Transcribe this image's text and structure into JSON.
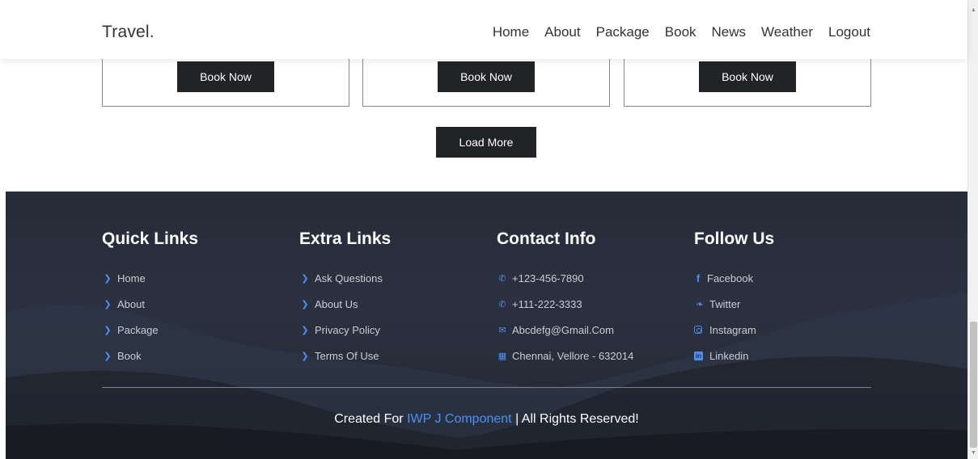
{
  "header": {
    "logo": "Travel.",
    "nav": [
      "Home",
      "About",
      "Package",
      "Book",
      "News",
      "Weather",
      "Logout"
    ]
  },
  "cards": [
    {
      "button": "Book Now"
    },
    {
      "button": "Book Now"
    },
    {
      "button": "Book Now"
    }
  ],
  "load_more": "Load More",
  "footer": {
    "quick_links": {
      "title": "Quick Links",
      "items": [
        "Home",
        "About",
        "Package",
        "Book"
      ]
    },
    "extra_links": {
      "title": "Extra Links",
      "items": [
        "Ask Questions",
        "About Us",
        "Privacy Policy",
        "Terms Of Use"
      ]
    },
    "contact_info": {
      "title": "Contact Info",
      "items": [
        {
          "icon": "phone-icon",
          "text": "+123-456-7890"
        },
        {
          "icon": "phone-icon",
          "text": "+111-222-3333"
        },
        {
          "icon": "envelope-icon",
          "text": "Abcdefg@Gmail.Com"
        },
        {
          "icon": "map-icon",
          "text": "Chennai, Vellore - 632014"
        }
      ]
    },
    "follow_us": {
      "title": "Follow Us",
      "items": [
        {
          "icon": "facebook-icon",
          "text": "Facebook"
        },
        {
          "icon": "twitter-icon",
          "text": "Twitter"
        },
        {
          "icon": "instagram-icon",
          "text": "Instagram"
        },
        {
          "icon": "linkedin-icon",
          "text": "Linkedin"
        }
      ]
    },
    "credit": {
      "prefix": "Created For",
      "highlight": "IWP J Component",
      "suffix": "| All Rights Reserved!"
    }
  },
  "colors": {
    "accent": "#4f8ff0",
    "button_bg": "#222326",
    "footer_bg": "#2b3140"
  }
}
